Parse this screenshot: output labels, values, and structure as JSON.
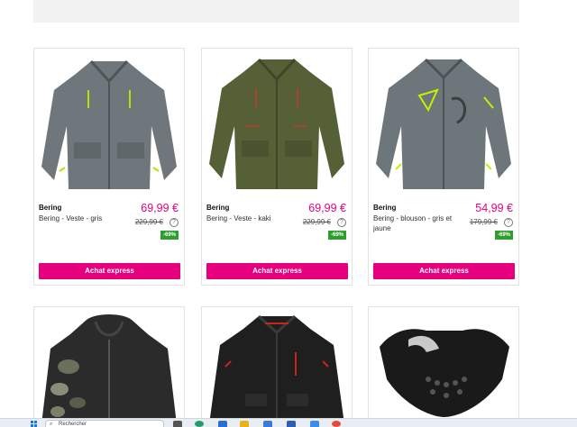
{
  "products": [
    {
      "brand": "Bering",
      "name": "Bering - Veste - gris",
      "price": "69,99 €",
      "old_price": "229,99 €",
      "discount": "-69%",
      "cta": "Achat express",
      "image": "grey-motorcycle-jacket",
      "color": "#6f777c"
    },
    {
      "brand": "Bering",
      "name": "Bering - Veste - kaki",
      "price": "69,99 €",
      "old_price": "229,99 €",
      "discount": "-69%",
      "cta": "Achat express",
      "image": "khaki-motorcycle-jacket",
      "color": "#566037"
    },
    {
      "brand": "Bering",
      "name": "Bering - blouson - gris et jaune",
      "price": "54,99 €",
      "old_price": "179,99 €",
      "discount": "-69%",
      "cta": "Achat express",
      "image": "grey-yellow-motorcycle-jacket",
      "color": "#6d767b"
    }
  ],
  "lower_products": [
    {
      "image": "camo-hooded-jacket"
    },
    {
      "image": "black-red-motorcycle-jacket"
    },
    {
      "image": "black-face-mask"
    }
  ],
  "taskbar": {
    "search_placeholder": "Rechercher"
  },
  "colors": {
    "accent": "#e6007e",
    "discount": "#2e9f2e"
  }
}
